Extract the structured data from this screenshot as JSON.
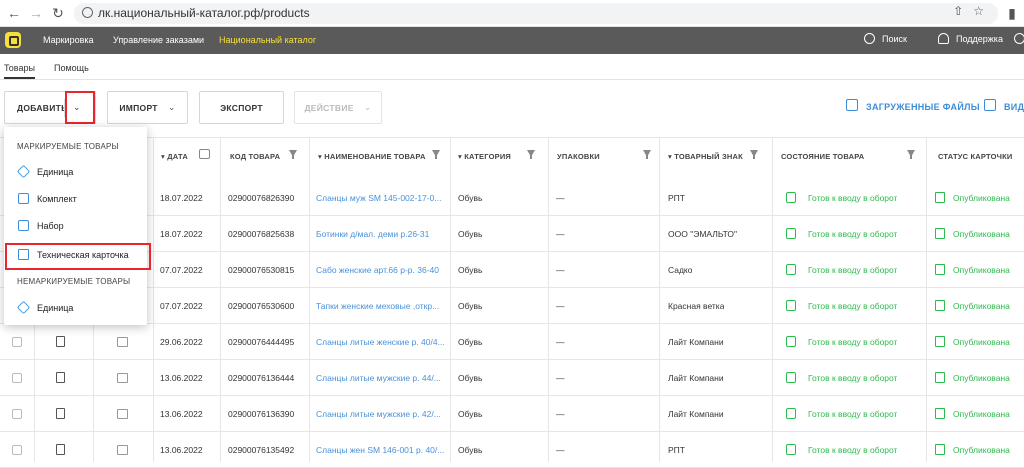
{
  "browser": {
    "url": "лк.национальный-каталог.рф/products"
  },
  "topbar": {
    "nav": [
      "Маркировка",
      "Управление заказами",
      "Национальный каталог"
    ],
    "search": "Поиск",
    "support": "Поддержка"
  },
  "subtabs": [
    "Товары",
    "Помощь"
  ],
  "toolbar": {
    "add": "ДОБАВИТЬ",
    "import": "ИМПОРТ",
    "export": "ЭКСПОРТ",
    "action": "ДЕЙСТВИЕ",
    "uploaded_files": "ЗАГРУЖЕННЫЕ ФАЙЛЫ",
    "view": "ВИД"
  },
  "colors": {
    "accent_yellow": "#f6e03b",
    "link_blue": "#3c8dd9",
    "status_green": "#2dbb4e",
    "highlight_red": "#e8262e"
  },
  "dropdown": {
    "section1": "МАРКИРУЕМЫЕ ТОВАРЫ",
    "items1": [
      "Единица",
      "Комплект",
      "Набор",
      "Техническая карточка"
    ],
    "section2": "НЕМАРКИРУЕМЫЕ ТОВАРЫ",
    "items2": [
      "Единица"
    ]
  },
  "table": {
    "headers": {
      "date": "ДАТА",
      "code": "КОД ТОВАРА",
      "name": "НАИМЕНОВАНИЕ ТОВАРА",
      "category": "КАТЕГОРИЯ",
      "package": "УПАКОВКИ",
      "brand": "ТОВАРНЫЙ ЗНАК",
      "state": "СОСТОЯНИЕ ТОВАРА",
      "card_status": "СТАТУС КАРТОЧКИ"
    },
    "rows": [
      {
        "date": "18.07.2022",
        "code": "02900076826390",
        "name": "Сланцы муж SM 145-002-17-0...",
        "category": "Обувь",
        "package": "—",
        "brand": "РПТ",
        "state": "Готов к вводу в оборот",
        "status": "Опубликована"
      },
      {
        "date": "18.07.2022",
        "code": "02900076825638",
        "name": "Ботинки д/мал. деми р.26-31",
        "category": "Обувь",
        "package": "—",
        "brand": "ООО \"ЭМАЛЬТО\"",
        "state": "Готов к вводу в оборот",
        "status": "Опубликована"
      },
      {
        "date": "07.07.2022",
        "code": "02900076530815",
        "name": "Сабо женские арт.66 р-р. 36-40",
        "category": "Обувь",
        "package": "—",
        "brand": "Садко",
        "state": "Готов к вводу в оборот",
        "status": "Опубликована"
      },
      {
        "date": "07.07.2022",
        "code": "02900076530600",
        "name": "Тапки женские меховые ,откр...",
        "category": "Обувь",
        "package": "—",
        "brand": "Красная ветка",
        "state": "Готов к вводу в оборот",
        "status": "Опубликована"
      },
      {
        "date": "29.06.2022",
        "code": "02900076444495",
        "name": "Сланцы литые женские р. 40/4...",
        "category": "Обувь",
        "package": "—",
        "brand": "Лайт Компани",
        "state": "Готов к вводу в оборот",
        "status": "Опубликована"
      },
      {
        "date": "13.06.2022",
        "code": "02900076136444",
        "name": "Сланцы литые мужские р. 44/...",
        "category": "Обувь",
        "package": "—",
        "brand": "Лайт Компани",
        "state": "Готов к вводу в оборот",
        "status": "Опубликована"
      },
      {
        "date": "13.06.2022",
        "code": "02900076136390",
        "name": "Сланцы литые мужские р. 42/...",
        "category": "Обувь",
        "package": "—",
        "brand": "Лайт Компани",
        "state": "Готов к вводу в оборот",
        "status": "Опубликована"
      },
      {
        "date": "13.06.2022",
        "code": "02900076135492",
        "name": "Сланцы жен SM 146-001 р. 40/...",
        "category": "Обувь",
        "package": "—",
        "brand": "РПТ",
        "state": "Готов к вводу в оборот",
        "status": "Опубликована"
      }
    ]
  }
}
